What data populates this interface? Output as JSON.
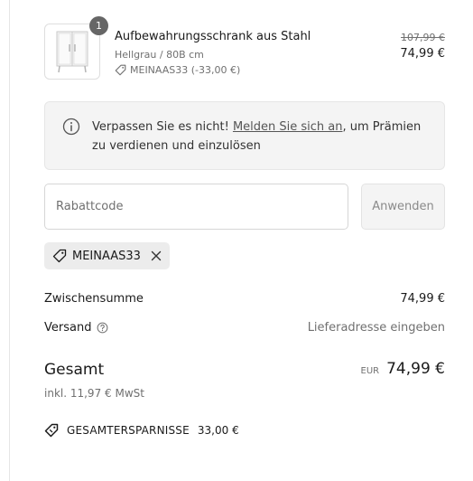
{
  "product": {
    "quantity": "1",
    "title": "Aufbewahrungsschrank aus Stahl",
    "variant": "Hellgrau / 80B cm",
    "discount": "MEINAAS33 (-33,00 €)",
    "old_price": "107,99 €",
    "price": "74,99 €",
    "image_icon": "metal-cabinet"
  },
  "notice": {
    "icon": "info-circle-icon",
    "text_before": "Verpassen Sie es nicht! ",
    "link": "Melden Sie sich an",
    "text_after": ", um Prämien zu verdienen und einzulösen"
  },
  "discount_code": {
    "placeholder": "Rabattcode",
    "value": "",
    "apply_label": "Anwenden",
    "applied_code": "MEINAAS33"
  },
  "summary": {
    "subtotal_label": "Zwischensumme",
    "subtotal_value": "74,99 €",
    "shipping_label": "Versand",
    "shipping_value": "Lieferadresse eingeben",
    "total_label": "Gesamt",
    "currency": "EUR",
    "total_value": "74,99 €",
    "tax_note": "inkl. 11,97 € MwSt",
    "savings_label": "GESAMTERSPARNISSE",
    "savings_value": "33,00 €"
  },
  "colors": {
    "accent_text": "#1a1a1a",
    "muted_text": "#707070",
    "panel_bg": "#f4f4f4",
    "badge_bg": "#666666"
  }
}
